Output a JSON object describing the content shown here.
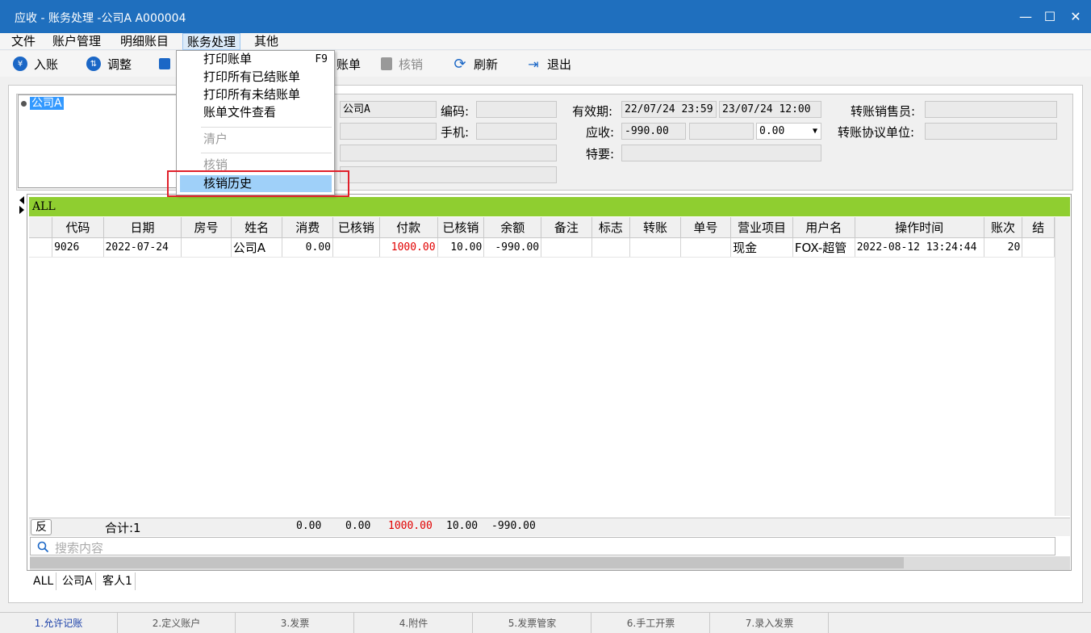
{
  "window": {
    "title": "应收 - 账务处理 -公司A  A000004"
  },
  "menu": [
    "文件",
    "账户管理",
    "明细账目",
    "账务处理",
    "其他"
  ],
  "toolbar": {
    "post": "入账",
    "adjust": "调整",
    "bill_tail": "账单",
    "writeoff": "核销",
    "refresh": "刷新",
    "exit": "退出"
  },
  "dropdown": {
    "print_bill": "打印账单",
    "print_bill_key": "F9",
    "print_all_closed": "打印所有已结账单",
    "print_all_open": "打印所有未结账单",
    "bill_file_view": "账单文件查看",
    "clear_account": "清户",
    "writeoff": "核销",
    "writeoff_history": "核销历史"
  },
  "tree": {
    "node": "公司A"
  },
  "info": {
    "name_value": "公司A",
    "code_label": "编码:",
    "code_value": "",
    "phone_label": "手机:",
    "phone_value": "",
    "valid_label": "有效期:",
    "valid_from": "22/07/24 23:59",
    "valid_to": "23/07/24 12:00",
    "receivable_label": "应收:",
    "receivable_value": "-990.00",
    "receivable_extra": "",
    "rate_value": "0.00",
    "remark_label": "特要:",
    "remark_value": "",
    "sales_label": "转账销售员:",
    "sales_value": "",
    "unit_label": "转账协议单位:",
    "unit_value": ""
  },
  "grid": {
    "group": "ALL",
    "columns": [
      "",
      "代码",
      "日期",
      "房号",
      "姓名",
      "消费",
      "已核销",
      "付款",
      "已核销",
      "余额",
      "备注",
      "标志",
      "转账",
      "单号",
      "营业项目",
      "用户名",
      "操作时间",
      "账次",
      "结"
    ],
    "rows": [
      [
        "",
        "9026",
        "2022-07-24",
        "",
        "公司A",
        "0.00",
        "",
        "1000.00",
        "10.00",
        "-990.00",
        "",
        "",
        "",
        "",
        "现金",
        "FOX-超管",
        "2022-08-12 13:24:44",
        "20",
        ""
      ]
    ]
  },
  "summary": {
    "reverse": "反",
    "total": "合计:1",
    "consume": "0.00",
    "written_off": "0.00",
    "payment": "1000.00",
    "payment_written_off": "10.00",
    "balance": "-990.00"
  },
  "search": {
    "placeholder": "搜索内容"
  },
  "group_tabs": [
    "ALL",
    "公司A",
    "客人1"
  ],
  "bottom_tabs": [
    "1.允许记账",
    "2.定义账户",
    "3.发票",
    "4.附件",
    "5.发票管家",
    "6.手工开票",
    "7.录入发票"
  ],
  "colors": {
    "title_bar": "#1f6fbe",
    "group_bar": "#8fce30",
    "highlight": "#e10000"
  }
}
